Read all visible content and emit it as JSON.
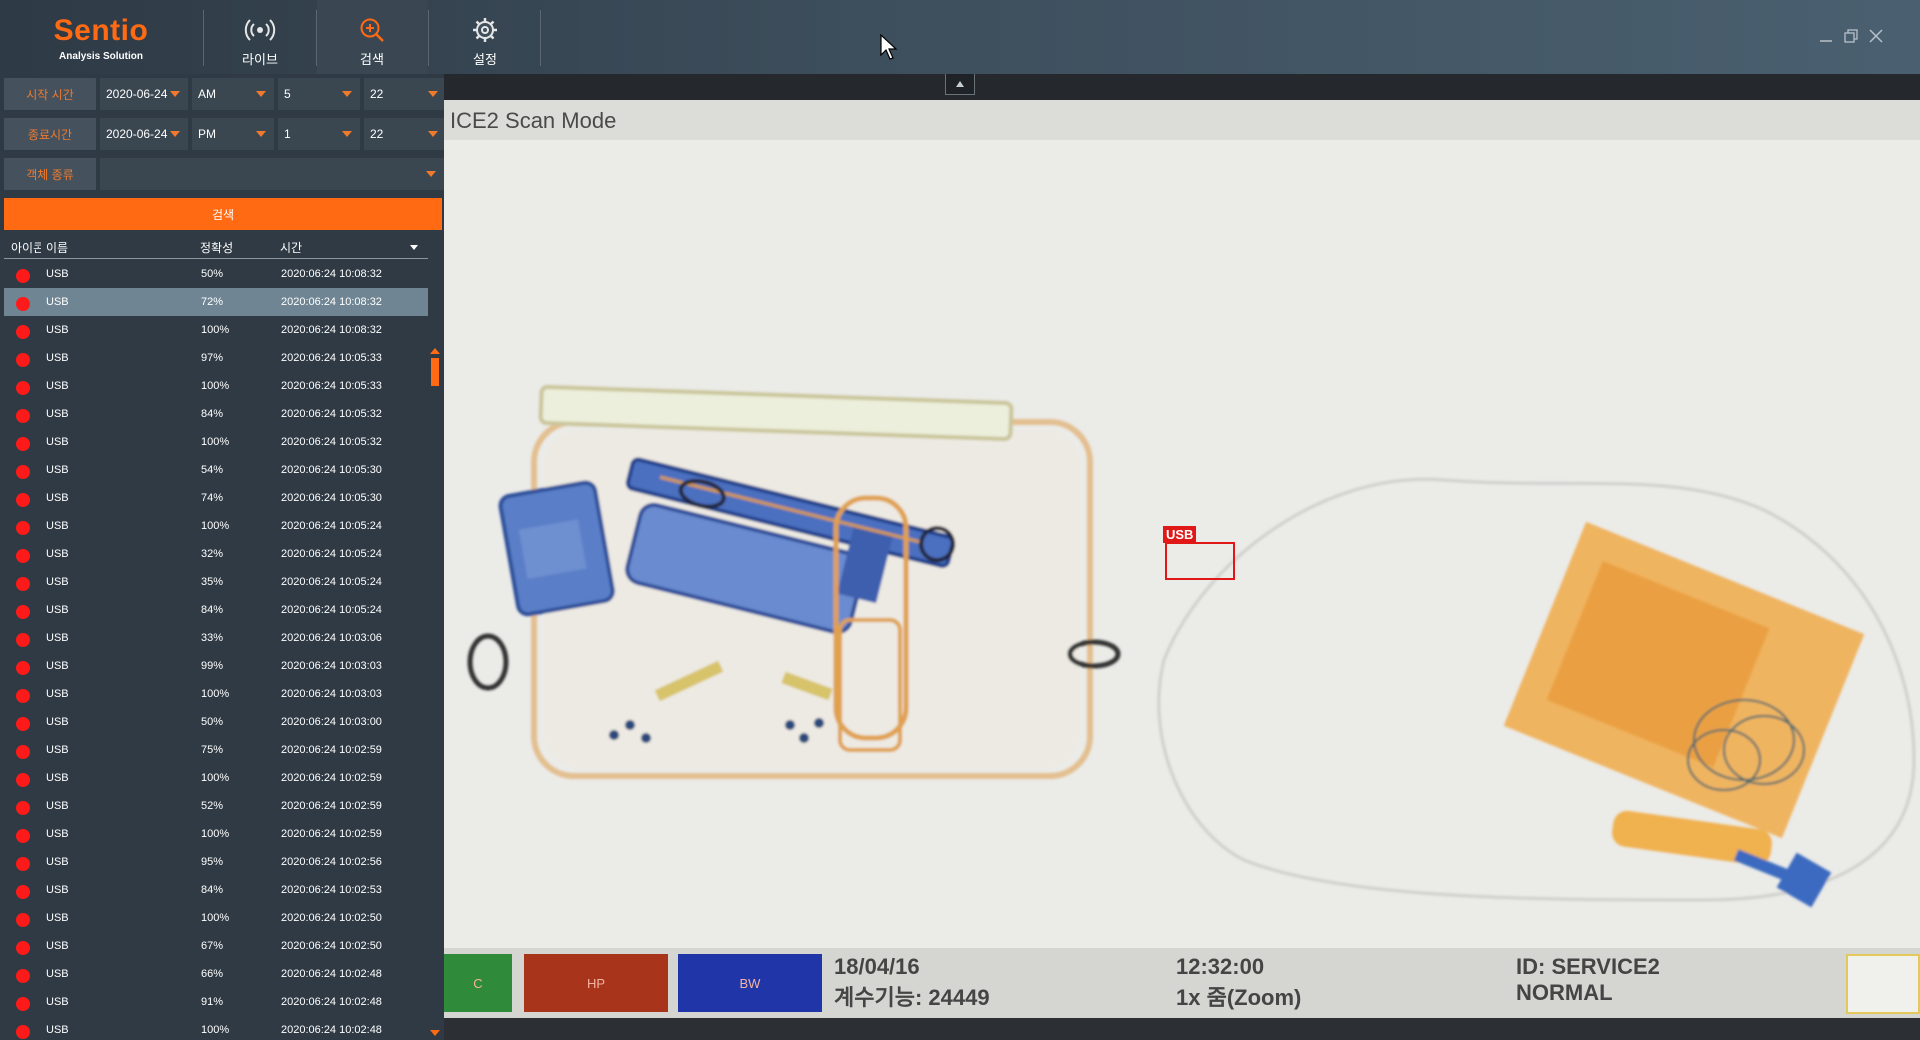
{
  "app": {
    "name": "Sentio",
    "subtitle": "Analysis Solution"
  },
  "nav": [
    {
      "label": "라이브",
      "icon": "live-broadcast-icon"
    },
    {
      "label": "검색",
      "icon": "search-icon",
      "active": true
    },
    {
      "label": "설정",
      "icon": "gear-icon"
    }
  ],
  "window_controls": [
    "minimize-icon",
    "restore-icon",
    "close-icon"
  ],
  "filters": {
    "start": {
      "label": "시작 시간",
      "date": "2020-06-24",
      "ampm": "AM",
      "hour": "5",
      "minute": "22"
    },
    "end": {
      "label": "종료시간",
      "date": "2020-06-24",
      "ampm": "PM",
      "hour": "1",
      "minute": "22"
    },
    "object_type": {
      "label": "객체 종류",
      "value": ""
    },
    "search_button": "검색"
  },
  "table": {
    "headers": {
      "icon": "아이콘",
      "name": "이름",
      "accuracy": "정확성",
      "time": "시간"
    },
    "selected_index": 1,
    "rows": [
      {
        "name": "USB",
        "accuracy": "50%",
        "time": "2020:06:24 10:08:32"
      },
      {
        "name": "USB",
        "accuracy": "72%",
        "time": "2020:06:24 10:08:32"
      },
      {
        "name": "USB",
        "accuracy": "100%",
        "time": "2020:06:24 10:08:32"
      },
      {
        "name": "USB",
        "accuracy": "97%",
        "time": "2020:06:24 10:05:33"
      },
      {
        "name": "USB",
        "accuracy": "100%",
        "time": "2020:06:24 10:05:33"
      },
      {
        "name": "USB",
        "accuracy": "84%",
        "time": "2020:06:24 10:05:32"
      },
      {
        "name": "USB",
        "accuracy": "100%",
        "time": "2020:06:24 10:05:32"
      },
      {
        "name": "USB",
        "accuracy": "54%",
        "time": "2020:06:24 10:05:30"
      },
      {
        "name": "USB",
        "accuracy": "74%",
        "time": "2020:06:24 10:05:30"
      },
      {
        "name": "USB",
        "accuracy": "100%",
        "time": "2020:06:24 10:05:24"
      },
      {
        "name": "USB",
        "accuracy": "32%",
        "time": "2020:06:24 10:05:24"
      },
      {
        "name": "USB",
        "accuracy": "35%",
        "time": "2020:06:24 10:05:24"
      },
      {
        "name": "USB",
        "accuracy": "84%",
        "time": "2020:06:24 10:05:24"
      },
      {
        "name": "USB",
        "accuracy": "33%",
        "time": "2020:06:24 10:03:06"
      },
      {
        "name": "USB",
        "accuracy": "99%",
        "time": "2020:06:24 10:03:03"
      },
      {
        "name": "USB",
        "accuracy": "100%",
        "time": "2020:06:24 10:03:03"
      },
      {
        "name": "USB",
        "accuracy": "50%",
        "time": "2020:06:24 10:03:00"
      },
      {
        "name": "USB",
        "accuracy": "75%",
        "time": "2020:06:24 10:02:59"
      },
      {
        "name": "USB",
        "accuracy": "100%",
        "time": "2020:06:24 10:02:59"
      },
      {
        "name": "USB",
        "accuracy": "52%",
        "time": "2020:06:24 10:02:59"
      },
      {
        "name": "USB",
        "accuracy": "100%",
        "time": "2020:06:24 10:02:59"
      },
      {
        "name": "USB",
        "accuracy": "95%",
        "time": "2020:06:24 10:02:56"
      },
      {
        "name": "USB",
        "accuracy": "84%",
        "time": "2020:06:24 10:02:53"
      },
      {
        "name": "USB",
        "accuracy": "100%",
        "time": "2020:06:24 10:02:50"
      },
      {
        "name": "USB",
        "accuracy": "67%",
        "time": "2020:06:24 10:02:50"
      },
      {
        "name": "USB",
        "accuracy": "66%",
        "time": "2020:06:24 10:02:48"
      },
      {
        "name": "USB",
        "accuracy": "91%",
        "time": "2020:06:24 10:02:48"
      },
      {
        "name": "USB",
        "accuracy": "100%",
        "time": "2020:06:24 10:02:48"
      }
    ]
  },
  "viewer": {
    "scan_title": "ICE2 Scan Mode",
    "detection_label": "USB",
    "color_buttons": [
      {
        "label": "C",
        "color": "#2f8a3a"
      },
      {
        "label": "HP",
        "color": "#a8341c"
      },
      {
        "label": "BW",
        "color": "#1f35a8"
      }
    ],
    "date": "18/04/16",
    "counter": "계수기능: 24449",
    "time": "12:32:00",
    "zoom": "1x 줌(Zoom)",
    "device_id": "ID: SERVICE2",
    "mode": "NORMAL"
  },
  "colors": {
    "accent": "#ff6a13",
    "detection": "#ff1a1a",
    "selected_row": "#6f8593"
  }
}
